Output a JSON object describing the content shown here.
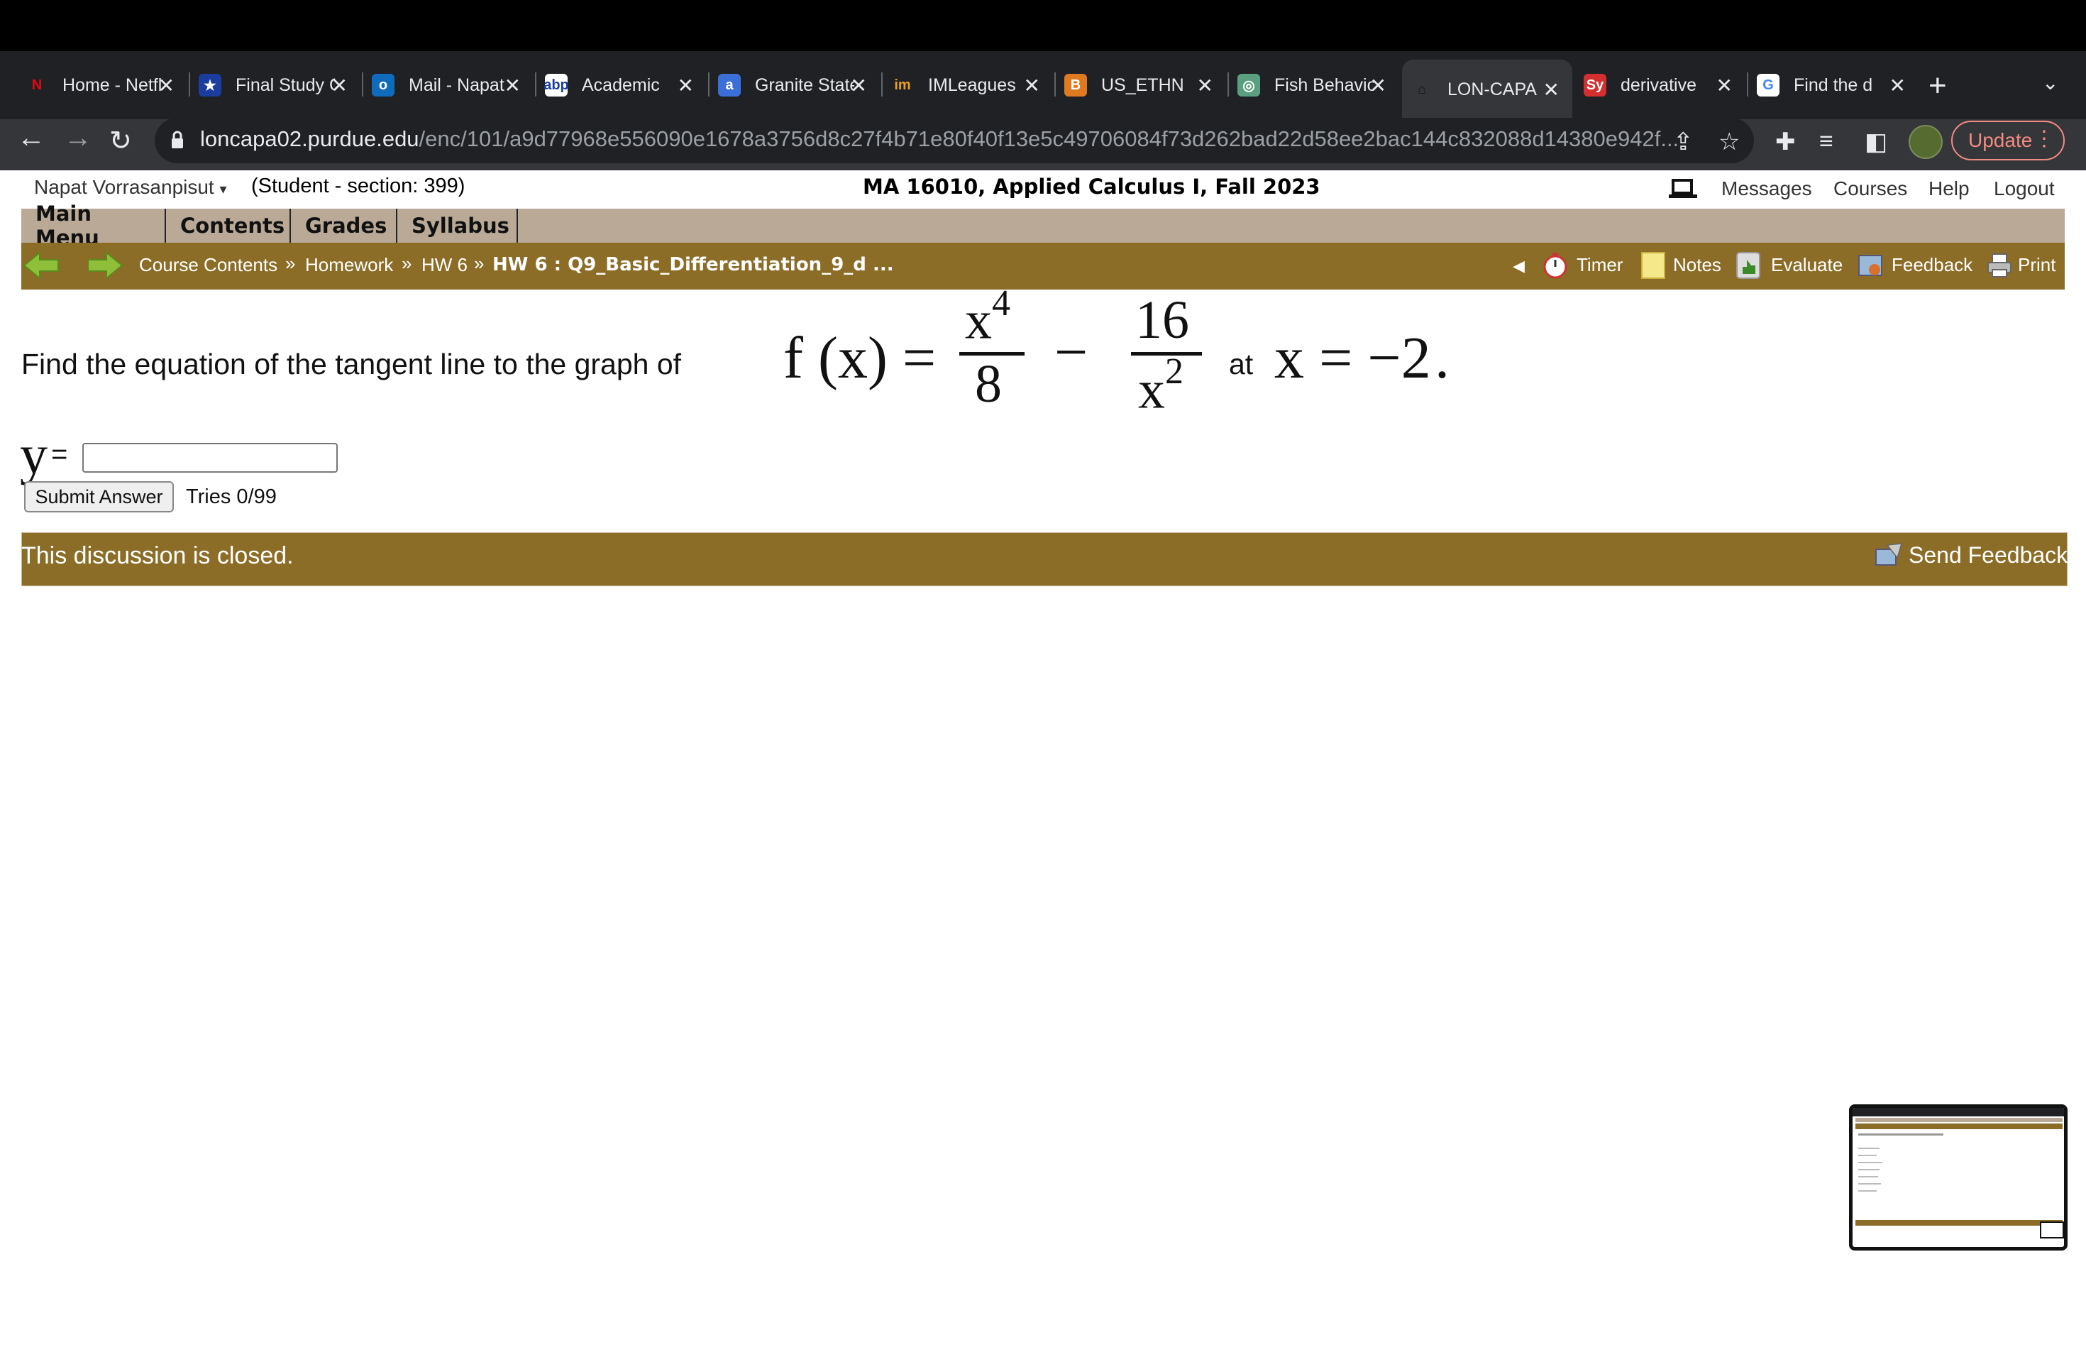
{
  "browser": {
    "tabs": [
      {
        "title": "Home - Netflix",
        "favicon": "N",
        "favicon_color": "#e50914",
        "favicon_bg": "#202124"
      },
      {
        "title": "Final Study Guide",
        "favicon": "★",
        "favicon_color": "#ffffff",
        "favicon_bg": "#1a3d9e"
      },
      {
        "title": "Mail - Napat",
        "favicon": "o",
        "favicon_color": "#ffffff",
        "favicon_bg": "#0f6cbd"
      },
      {
        "title": "Academic",
        "favicon": "abp",
        "favicon_color": "#1a3d9e",
        "favicon_bg": "#ffffff"
      },
      {
        "title": "Granite State",
        "favicon": "a",
        "favicon_color": "#ffffff",
        "favicon_bg": "#3a6fd8"
      },
      {
        "title": "IMLeagues",
        "favicon": "im",
        "favicon_color": "#e8a020",
        "favicon_bg": "#202124"
      },
      {
        "title": "US_ETHN",
        "favicon": "B",
        "favicon_color": "#ffffff",
        "favicon_bg": "#e07a20"
      },
      {
        "title": "Fish Behavior",
        "favicon": "◎",
        "favicon_color": "#ffffff",
        "favicon_bg": "#5aa080"
      },
      {
        "title": "LON-CAPA",
        "favicon": "⌂",
        "favicon_color": "#111111",
        "favicon_bg": "#35363a"
      },
      {
        "title": "derivative",
        "favicon": "Sy",
        "favicon_color": "#ffffff",
        "favicon_bg": "#d32f2f"
      },
      {
        "title": "Find the d",
        "favicon": "G",
        "favicon_color": "#4285f4",
        "favicon_bg": "#ffffff"
      }
    ],
    "new_tab": "+",
    "url_host": "loncapa02.purdue.edu",
    "url_path": "/enc/101/a9d77968e556090e1678a3756d8c27f4b71e80f40f13e5c49706084f73d262bad22d58ee2bac144c832088d14380e942f...",
    "update_label": "Update"
  },
  "header": {
    "user_name": "Napat Vorrasanpisut",
    "user_role": "(Student  - section: 399)",
    "course_title": "MA 16010, Applied Calculus I, Fall 2023",
    "links": [
      "Messages",
      "Courses",
      "Help",
      "Logout"
    ]
  },
  "menu": [
    "Main Menu",
    "Contents",
    "Grades",
    "Syllabus"
  ],
  "breadcrumb": {
    "items": [
      "Course Contents",
      "Homework",
      "HW 6"
    ],
    "current": "HW 6 : Q9_Basic_Differentiation_9_d ...",
    "separator": "»"
  },
  "tools": [
    "Timer",
    "Notes",
    "Evaluate",
    "Feedback",
    "Print"
  ],
  "problem": {
    "text": "Find the equation of the tangent line to the graph of",
    "fx": "f (x) =",
    "term1_num": "x",
    "term1_num_exp": "4",
    "term1_den": "8",
    "minus": "−",
    "term2_num": "16",
    "term2_den": "x",
    "term2_den_exp": "2",
    "at": "at",
    "x_eq": "x = −2",
    "period": ".",
    "answer_label": "y",
    "answer_eq": "=",
    "answer_value": "",
    "submit_label": "Submit Answer",
    "tries": "Tries 0/99"
  },
  "discussion": {
    "status": "This discussion is closed.",
    "send_feedback": "Send Feedback"
  },
  "colors": {
    "bar_brown": "#8c6d28",
    "menu_tan": "#b9a996",
    "chrome_dark": "#202124",
    "chrome_toolbar": "#35363a",
    "update_accent": "#f28b82"
  }
}
